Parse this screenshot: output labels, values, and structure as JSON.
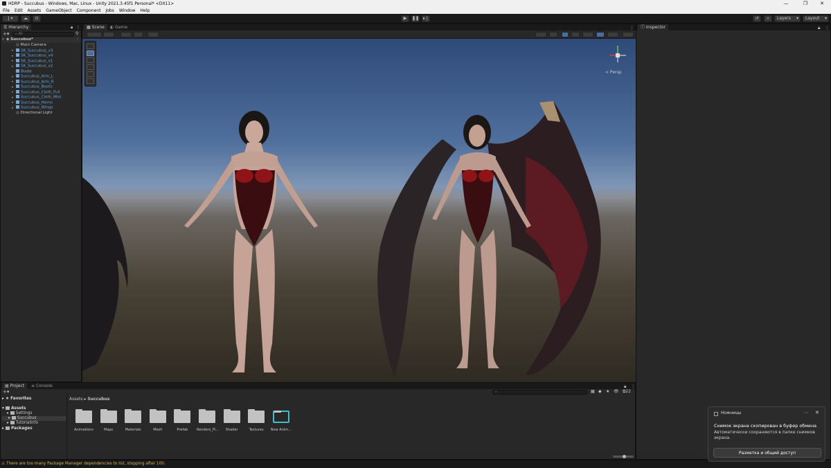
{
  "window": {
    "title": "HDRP - Succubus - Windows, Mac, Linux - Unity 2021.3.45f1 Personal* <DX11>",
    "controls": [
      "—",
      "❐",
      "✕"
    ]
  },
  "menu": [
    "File",
    "Edit",
    "Assets",
    "GameObject",
    "Component",
    "Jobs",
    "Window",
    "Help"
  ],
  "toolbar": {
    "account_label": "J",
    "layers_label": "Layers",
    "layout_label": "Layout"
  },
  "hierarchy": {
    "tab_label": "Hierarchy",
    "search_placeholder": "All",
    "scene_name": "Succubus*",
    "items": [
      {
        "label": "Main Camera",
        "prefab": false,
        "expandable": false
      },
      {
        "label": "SK_Succubus_v3",
        "prefab": true,
        "expandable": true
      },
      {
        "label": "SK_Succubus_v4",
        "prefab": true,
        "expandable": true
      },
      {
        "label": "SK_Succubus_v1",
        "prefab": true,
        "expandable": true
      },
      {
        "label": "SK_Succubus_v2",
        "prefab": true,
        "expandable": true
      },
      {
        "label": "Blade",
        "prefab": true,
        "expandable": false
      },
      {
        "label": "Succubus_Arm_L",
        "prefab": true,
        "expandable": true
      },
      {
        "label": "Succubus_Arm_R",
        "prefab": true,
        "expandable": true
      },
      {
        "label": "Succubus_Boots",
        "prefab": true,
        "expandable": true
      },
      {
        "label": "Succubus_Cloth_Full",
        "prefab": true,
        "expandable": true
      },
      {
        "label": "Succubus_Cloth_Mini",
        "prefab": true,
        "expandable": true
      },
      {
        "label": "Succubus_Horns",
        "prefab": true,
        "expandable": true
      },
      {
        "label": "Succubus_Wings",
        "prefab": true,
        "expandable": true
      },
      {
        "label": "Directional Light",
        "prefab": false,
        "expandable": false
      }
    ]
  },
  "scene_view": {
    "tabs": [
      "Scene",
      "Game"
    ],
    "projection_label": "< Persp"
  },
  "inspector": {
    "tab_label": "Inspector"
  },
  "project": {
    "tabs": [
      "Project",
      "Console"
    ],
    "breadcrumb": [
      "Assets",
      "Succubus"
    ],
    "item_count": "22",
    "tree": {
      "favorites": "Favorites",
      "assets": "Assets",
      "assets_children": [
        "Settings",
        "Succubus",
        "TutorialInfo"
      ],
      "packages": "Packages"
    },
    "folders": [
      "Animations",
      "Maps",
      "Materials",
      "Mesh",
      "Prefab",
      "Renders_Pi...",
      "Shader",
      "Textures",
      "New Anim..."
    ]
  },
  "status": {
    "message": "There are too many Package Manager dependencies to list, stopping after 100."
  },
  "notification": {
    "app": "Ножницы",
    "title": "Снимок экрана скопирован в буфер обмена",
    "body": "Автоматически сохраняются в папке снимков экрана.",
    "action": "Разметка и общий доступ"
  },
  "colors": {
    "editor_bg": "#191919",
    "panel_bg": "#282828",
    "prefab_blue": "#6fa8dc",
    "warning_yellow": "#d7b15a"
  }
}
